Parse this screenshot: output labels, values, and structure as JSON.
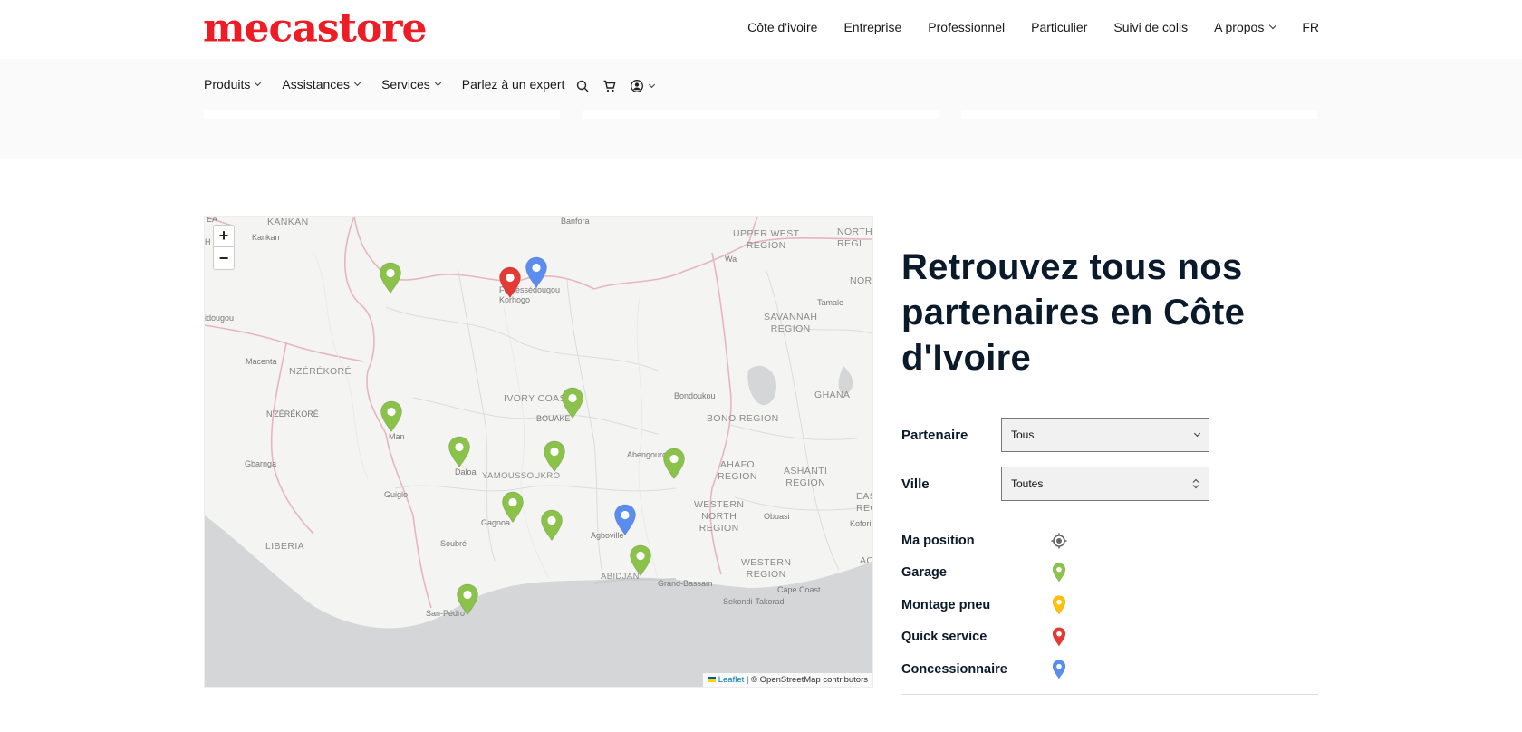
{
  "brand": {
    "logo_text": "mecastore",
    "logo_color": "#ee1c25"
  },
  "top_nav": {
    "items": [
      {
        "label": "Côte d'ivoire"
      },
      {
        "label": "Entreprise"
      },
      {
        "label": "Professionnel"
      },
      {
        "label": "Particulier"
      },
      {
        "label": "Suivi de colis"
      },
      {
        "label": "A propos"
      },
      {
        "label": "FR"
      }
    ]
  },
  "sub_nav": {
    "items": [
      {
        "label": "Produits"
      },
      {
        "label": "Assistances"
      },
      {
        "label": "Services"
      },
      {
        "label": "Parlez à un expert"
      }
    ],
    "icons": [
      "search-icon",
      "cart-icon",
      "user-account-icon"
    ]
  },
  "map": {
    "zoom_in": "+",
    "zoom_out": "−",
    "attribution_leaflet": "Leaflet",
    "attribution_rest": "| © OpenStreetMap contributors",
    "labels": {
      "kankan_region": "KANKAN",
      "kankan_city": "Kankan",
      "banfora": "Banfora",
      "upper_west": "UPPER WEST\nREGION",
      "north_region": "NORTH\nREGI",
      "wa": "Wa",
      "ferkessedougou": "Ferkéssédougou",
      "korhogo": "Korhogo",
      "odienne": "idougou",
      "tamale": "Tamale",
      "nort": "NOR",
      "savannah": "SAVANNAH\nREGION",
      "macenta": "Macenta",
      "nzerekore_region": "NZÉRÉKORÉ",
      "nzerekore_city": "N'ZÉRÉKORÉ",
      "ivory_coast": "IVORY COAST",
      "bouake": "BOUAKE",
      "bondoukou": "Bondoukou",
      "ghana": "GHANA",
      "bono": "BONO REGION",
      "man": "Man",
      "gbarnga": "Gbarnga",
      "daloa": "Daloa",
      "yamoussoukro": "YAMOUSSOUKRO",
      "abengourou": "Abengourou",
      "ahafo": "AHAFO\nREGION",
      "ashanti": "ASHANTI\nREGION",
      "guiglo": "Guiglo",
      "gagnoa": "Gagnoa",
      "agboville": "Agboville",
      "western_north": "WESTERN\nNORTH\nREGION",
      "obuasi": "Obuasi",
      "eas": "EAS\nREG",
      "koforidua": "Kofori",
      "liberia": "LIBERIA",
      "soubre": "Soubré",
      "abidjan": "ABIDJAN",
      "grand_bassam": "Grand-Bassam",
      "western_region": "WESTERN\nREGION",
      "acc": "ACC",
      "cape_coast": "Cape Coast",
      "sekondi": "Sekondi-Takoradi",
      "san_pedro": "San-Pédro",
      "ea": "EA",
      "h": "H"
    },
    "markers": [
      {
        "type": "garage",
        "name": "marker-odienne"
      },
      {
        "type": "quick",
        "name": "marker-korhogo"
      },
      {
        "type": "dealer",
        "name": "marker-ferkessedougou"
      },
      {
        "type": "garage",
        "name": "marker-bouake"
      },
      {
        "type": "garage",
        "name": "marker-man"
      },
      {
        "type": "garage",
        "name": "marker-daloa"
      },
      {
        "type": "garage",
        "name": "marker-yamoussoukro"
      },
      {
        "type": "garage",
        "name": "marker-abengourou"
      },
      {
        "type": "garage",
        "name": "marker-gagnoa"
      },
      {
        "type": "garage",
        "name": "marker-divo"
      },
      {
        "type": "dealer",
        "name": "marker-agboville"
      },
      {
        "type": "garage",
        "name": "marker-abidjan"
      },
      {
        "type": "garage",
        "name": "marker-san-pedro"
      }
    ]
  },
  "panel": {
    "title": "Retrouvez tous nos partenaires en Côte d'Ivoire",
    "filters": [
      {
        "label": "Partenaire",
        "value": "Tous"
      },
      {
        "label": "Ville",
        "value": "Toutes"
      }
    ],
    "legend": [
      {
        "label": "Ma position",
        "icon": "target-icon",
        "color": "#666666"
      },
      {
        "label": "Garage",
        "icon": "garage-pin-icon",
        "color": "#8bc34a"
      },
      {
        "label": "Montage pneu",
        "icon": "tire-pin-icon",
        "color": "#ffc107"
      },
      {
        "label": "Quick service",
        "icon": "quick-service-pin-icon",
        "color": "#e53935"
      },
      {
        "label": "Concessionnaire",
        "icon": "dealer-pin-icon",
        "color": "#5b8def"
      }
    ]
  },
  "colors": {
    "garage": "#8bc34a",
    "quick": "#e53935",
    "dealer": "#5b8def",
    "tire": "#ffc107"
  }
}
